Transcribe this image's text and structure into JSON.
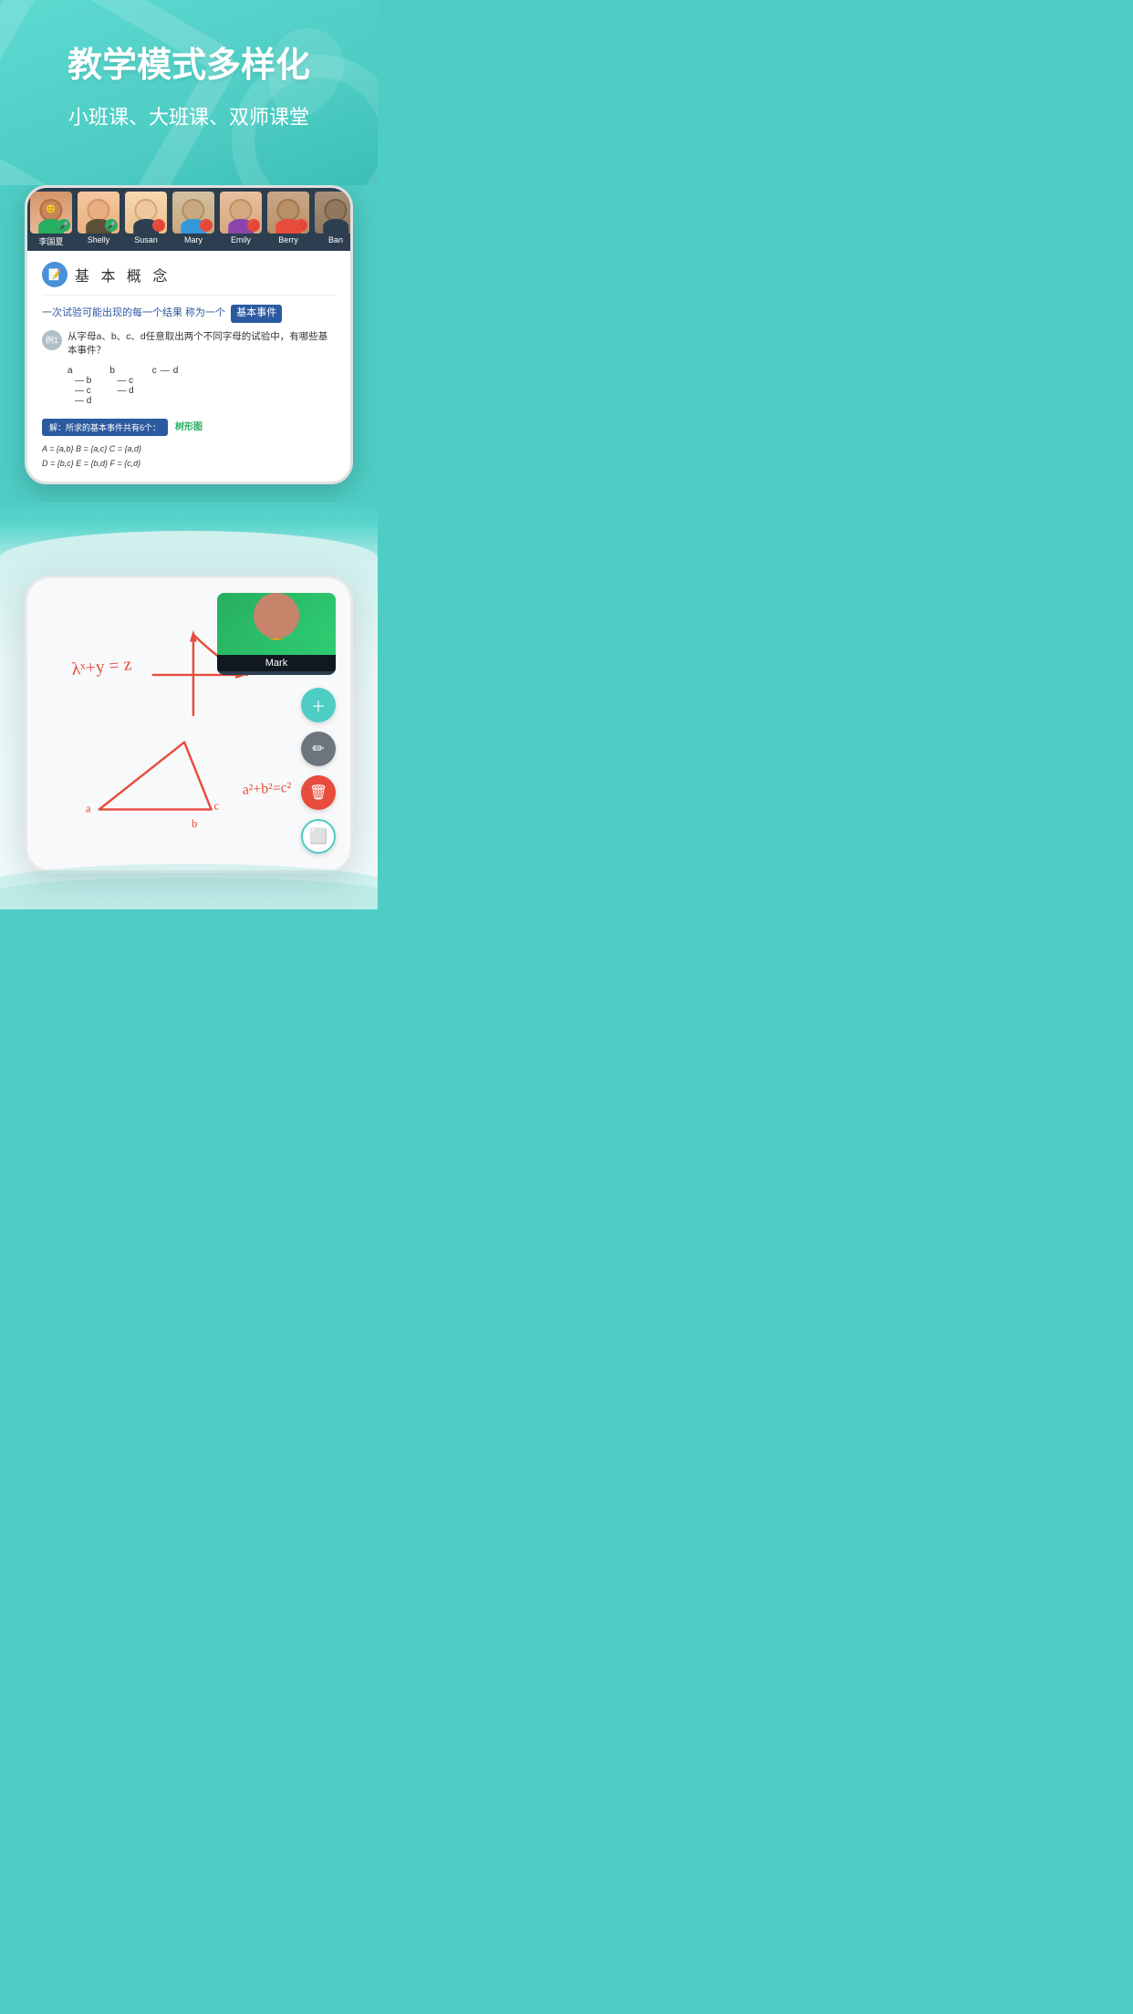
{
  "page": {
    "main_title": "教学模式多样化",
    "sub_title": "小班课、大班课、双师课堂"
  },
  "participants": [
    {
      "id": "p1",
      "name": "李国夏",
      "mic_active": true,
      "color": "#e8a87c"
    },
    {
      "id": "p2",
      "name": "Shelly",
      "mic_active": true,
      "color": "#c9a96e"
    },
    {
      "id": "p3",
      "name": "Susan",
      "mic_active": false,
      "color": "#d4b896"
    },
    {
      "id": "p4",
      "name": "Mary",
      "mic_active": false,
      "color": "#b8956a"
    },
    {
      "id": "p5",
      "name": "Emily",
      "mic_active": false,
      "color": "#a8876a"
    },
    {
      "id": "p6",
      "name": "Berry",
      "mic_active": false,
      "color": "#9a7d6a"
    },
    {
      "id": "p7",
      "name": "Ban",
      "mic_active": false,
      "color": "#8a7060"
    }
  ],
  "content": {
    "section_title": "基 本 概 念",
    "formula_line": "一次试验可能出现的每一个结果 称为一个",
    "highlight_text": "基本事件",
    "question_num": "例1",
    "question_text": "从字母a、b、c、d任意取出两个不同字母的试验中，有哪些基本事件？",
    "answer_label": "解：所求的基本事件共有6个：",
    "tree_link_label": "树形图",
    "sets": [
      "A = {a,b}    B = {a,c}    C = {a,d}",
      "D = {b,c}    E = {b,d}    F = {c,d}"
    ]
  },
  "whiteboard": {
    "formula1": "λˣ+y = z",
    "formula2": "a² + b² = c²",
    "person_name": "Mark"
  },
  "toolbar": {
    "tools": [
      {
        "icon": "✏️",
        "label": "add-tool"
      },
      {
        "icon": "✏",
        "label": "pen-tool"
      },
      {
        "icon": "🗑",
        "label": "eraser-tool"
      },
      {
        "icon": "📋",
        "label": "board-tool"
      }
    ]
  }
}
